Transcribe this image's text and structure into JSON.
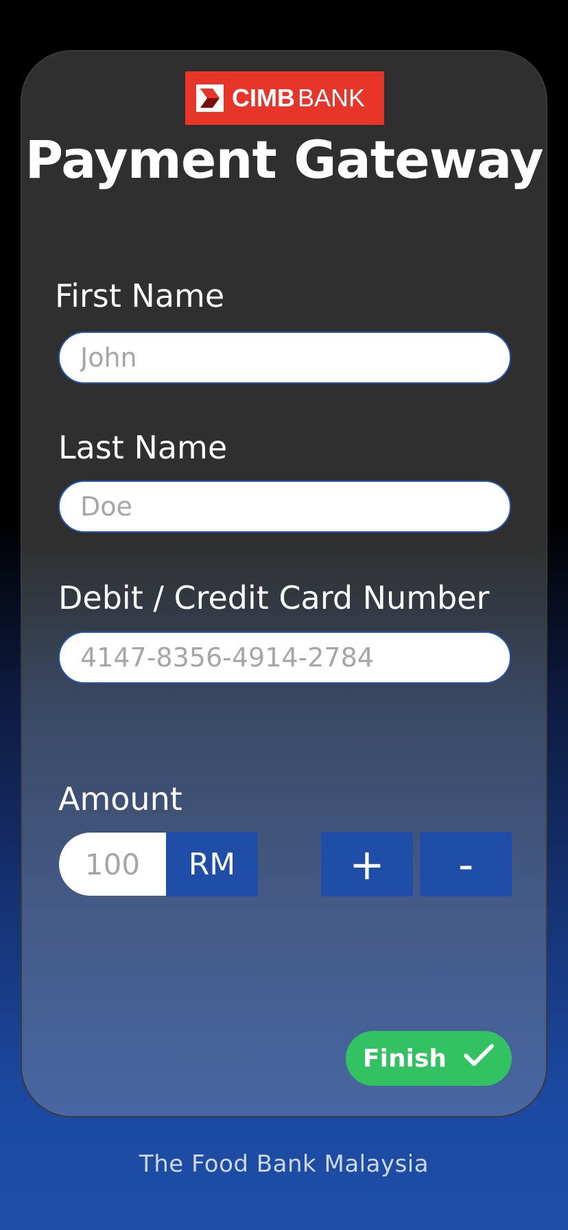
{
  "logo": {
    "brand_bold": "CIMB",
    "brand_light": "BANK",
    "background": "#e8352a"
  },
  "title": "Payment Gateway",
  "form": {
    "first_name": {
      "label": "First Name",
      "placeholder": "John"
    },
    "last_name": {
      "label": "Last Name",
      "placeholder": "Doe"
    },
    "card_number": {
      "label": "Debit / Credit Card Number",
      "placeholder": "4147-8356-4914-2784"
    },
    "amount": {
      "label": "Amount",
      "placeholder": "100",
      "currency": "RM",
      "increment_label": "+",
      "decrement_label": "-"
    }
  },
  "finish": {
    "label": "Finish",
    "color": "#33c262"
  },
  "footer": "The Food Bank Malaysia",
  "colors": {
    "accent_blue": "#1f4ea8",
    "card_background": "#2f2f2f"
  },
  "icons": {
    "logo_mark": "cimb-chevron-icon",
    "finish_icon": "check-icon"
  }
}
